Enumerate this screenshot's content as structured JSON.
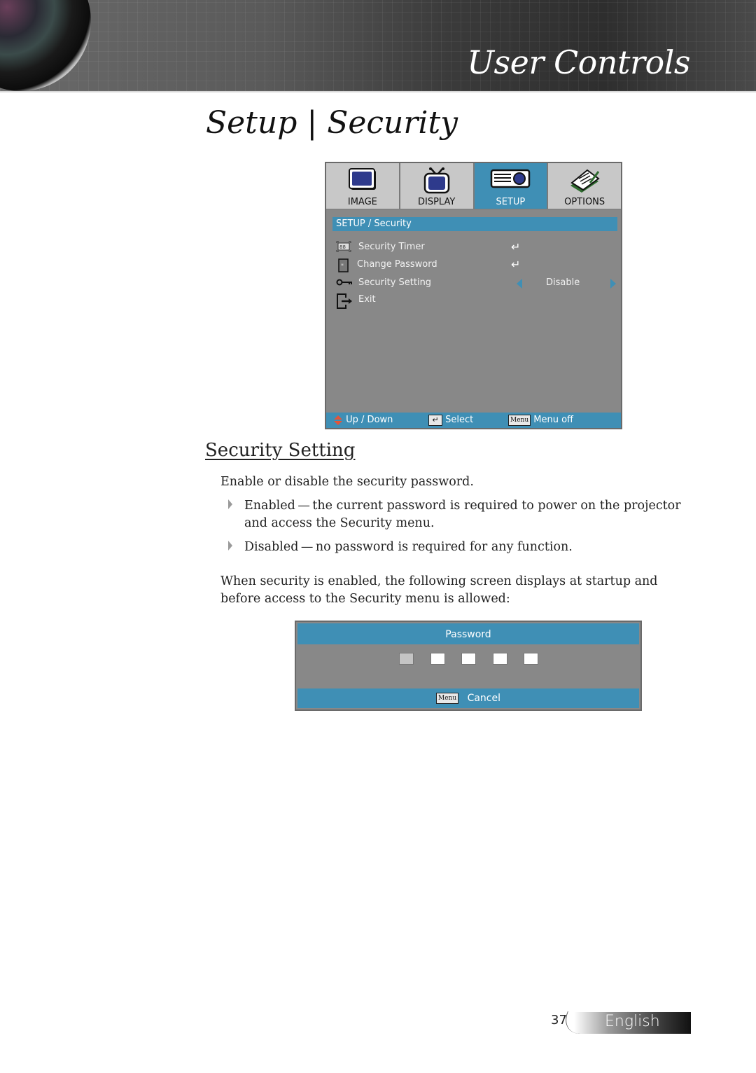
{
  "header": {
    "banner_title": "User Controls",
    "page_title_left": "Setup",
    "page_title_sep": "|",
    "page_title_right": "Security"
  },
  "osd_menu": {
    "tabs": [
      {
        "label": "IMAGE",
        "icon": "monitor-icon",
        "active": false
      },
      {
        "label": "DISPLAY",
        "icon": "tv-icon",
        "active": false
      },
      {
        "label": "SETUP",
        "icon": "projector-icon",
        "active": true
      },
      {
        "label": "OPTIONS",
        "icon": "notepad-icon",
        "active": false
      }
    ],
    "breadcrumb": "SETUP / Security",
    "items": [
      {
        "label": "Security Timer",
        "icon": "timer-icon",
        "control": "enter",
        "control_glyph": "↵"
      },
      {
        "label": "Change Password",
        "icon": "password-icon",
        "control": "enter",
        "control_glyph": "↵"
      },
      {
        "label": "Security Setting",
        "icon": "key-icon",
        "control": "selector",
        "value": "Disable"
      },
      {
        "label": "Exit",
        "icon": "exit-icon",
        "control": "none"
      }
    ],
    "footer": {
      "updown_label": "Up / Down",
      "select_label": "Select",
      "select_key": "↵",
      "menu_key": "Menu",
      "menu_off_label": "Menu off"
    },
    "colors": {
      "accent": "#3f8fb5",
      "panel": "#888888",
      "tab": "#c8c8c8"
    }
  },
  "section": {
    "heading": "Security Setting",
    "intro": "Enable or disable the security password.",
    "bullets": [
      {
        "line1": "Enabled — the current password is required to power on the projector",
        "line2": "and access the Security menu."
      },
      {
        "line1": "Disabled — no password is required for any function.",
        "line2": ""
      }
    ],
    "note_line1": "When security is enabled, the following screen displays at startup and",
    "note_line2": "before access to the Security menu is allowed:"
  },
  "password_dialog": {
    "title": "Password",
    "digits_total": 5,
    "digits_entered": 1,
    "menu_key": "Menu",
    "cancel_label": "Cancel"
  },
  "page_footer": {
    "page_number": "37",
    "language": "English"
  }
}
